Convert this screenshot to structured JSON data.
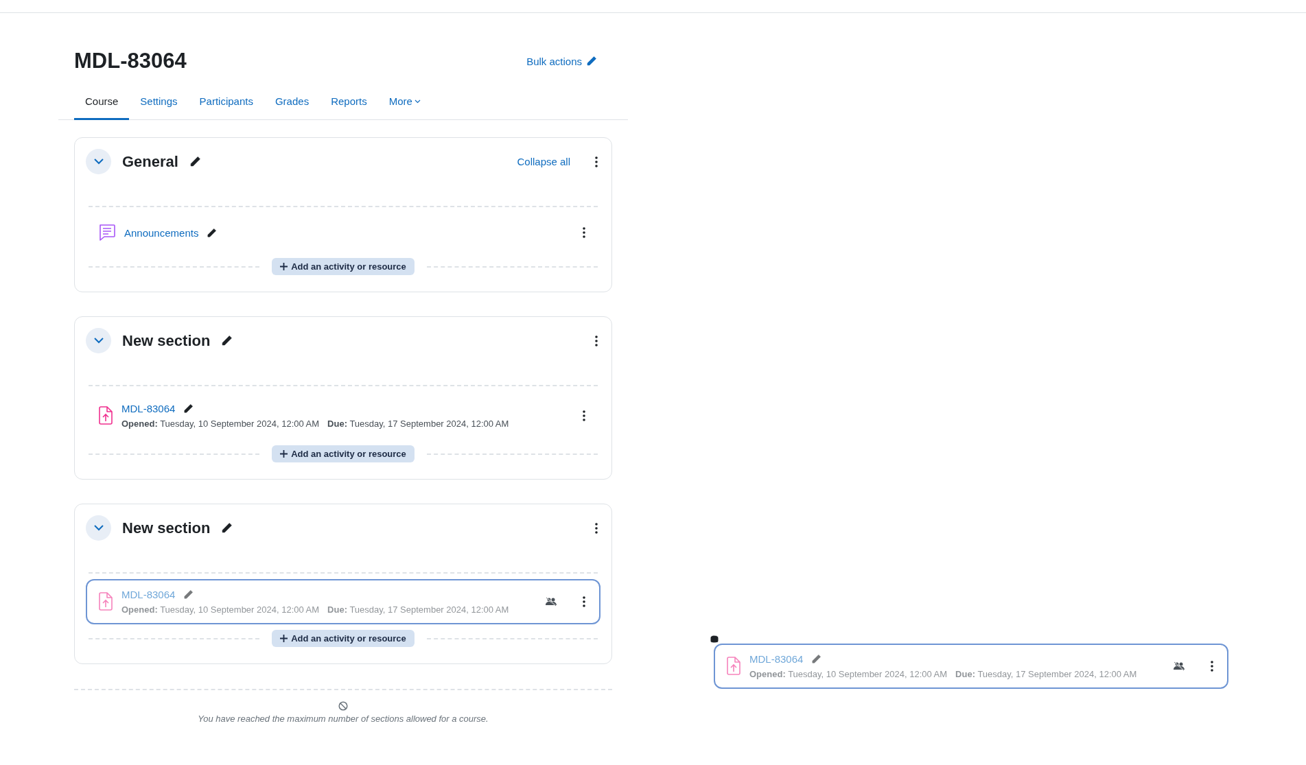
{
  "course": {
    "title": "MDL-83064",
    "bulk_actions": "Bulk actions"
  },
  "tabs": [
    {
      "label": "Course",
      "selected": true
    },
    {
      "label": "Settings",
      "selected": false
    },
    {
      "label": "Participants",
      "selected": false
    },
    {
      "label": "Grades",
      "selected": false
    },
    {
      "label": "Reports",
      "selected": false
    },
    {
      "label": "More",
      "selected": false,
      "dropdown": true
    }
  ],
  "sections": [
    {
      "title": "General",
      "expanded": true,
      "collapse_all": "Collapse all",
      "add_button": "Add an activity or resource",
      "items": [
        {
          "kind": "forum",
          "name": "Announcements",
          "dragging": false,
          "group_mode": false
        }
      ]
    },
    {
      "title": "New section",
      "expanded": true,
      "add_button": "Add an activity or resource",
      "items": [
        {
          "kind": "assignment",
          "name": "MDL-83064",
          "dragging": false,
          "group_mode": false,
          "opened_label": "Opened:",
          "opened": "Tuesday, 10 September 2024, 12:00 AM",
          "due_label": "Due:",
          "due": "Tuesday, 17 September 2024, 12:00 AM"
        }
      ]
    },
    {
      "title": "New section",
      "expanded": true,
      "add_button": "Add an activity or resource",
      "items": [
        {
          "kind": "assignment",
          "name": "MDL-83064",
          "dragging": true,
          "group_mode": true,
          "opened_label": "Opened:",
          "opened": "Tuesday, 10 September 2024, 12:00 AM",
          "due_label": "Due:",
          "due": "Tuesday, 17 September 2024, 12:00 AM"
        }
      ]
    }
  ],
  "limit_notice": "You have reached the maximum number of sections allowed for a course.",
  "drag_proxy": {
    "kind": "assignment",
    "name": "MDL-83064",
    "dragging": true,
    "group_mode": true,
    "opened_label": "Opened:",
    "opened": "Tuesday, 10 September 2024, 12:00 AM",
    "due_label": "Due:",
    "due": "Tuesday, 17 September 2024, 12:00 AM"
  }
}
